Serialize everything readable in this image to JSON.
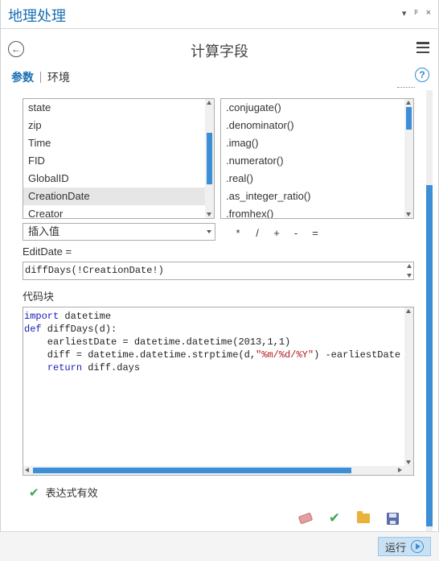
{
  "app": {
    "title": "地理处理",
    "controls": [
      "▾",
      "ᵖ",
      "×"
    ]
  },
  "header": {
    "title": "计算字段"
  },
  "tabs": {
    "active": "参数",
    "other": "环境"
  },
  "fields_list": {
    "items": [
      "state",
      "zip",
      "Time",
      "FID",
      "GlobalID",
      "CreationDate",
      "Creator"
    ],
    "selected": "CreationDate"
  },
  "helpers_list": {
    "items": [
      ".conjugate()",
      ".denominator()",
      ".imag()",
      ".numerator()",
      ".real()",
      ".as_integer_ratio()",
      ".fromhex()"
    ]
  },
  "insert_value": {
    "label": "插入值"
  },
  "operators": [
    "*",
    "/",
    "+",
    "-",
    "="
  ],
  "expression": {
    "label": "EditDate =",
    "value": "diffDays(!CreationDate!)"
  },
  "code_block": {
    "label": "代码块",
    "lines": [
      {
        "parts": [
          {
            "t": "import",
            "c": "kw"
          },
          {
            "t": " datetime",
            "c": ""
          }
        ]
      },
      {
        "parts": [
          {
            "t": "def",
            "c": "kw"
          },
          {
            "t": " diffDays(d):",
            "c": ""
          }
        ]
      },
      {
        "parts": [
          {
            "t": "    earliestDate = datetime.datetime(2013,1,1)",
            "c": ""
          }
        ]
      },
      {
        "parts": [
          {
            "t": "    diff = datetime.datetime.strptime(d,",
            "c": ""
          },
          {
            "t": "\"%m/%d/%Y\"",
            "c": "str"
          },
          {
            "t": ") -earliestDate",
            "c": ""
          }
        ]
      },
      {
        "parts": [
          {
            "t": "    ",
            "c": ""
          },
          {
            "t": "return",
            "c": "kw"
          },
          {
            "t": " diff.days",
            "c": ""
          }
        ]
      }
    ]
  },
  "validation": {
    "message": "表达式有效"
  },
  "footer": {
    "run_label": "运行"
  },
  "colors": {
    "accent": "#1a6fb3",
    "scrollbar": "#3c8fd6",
    "valid": "#3aa655"
  },
  "icons": [
    "back-arrow-icon",
    "hamburger-menu-icon",
    "help-icon",
    "check-icon",
    "eraser-icon",
    "verify-icon",
    "folder-icon",
    "save-icon",
    "run-icon"
  ]
}
